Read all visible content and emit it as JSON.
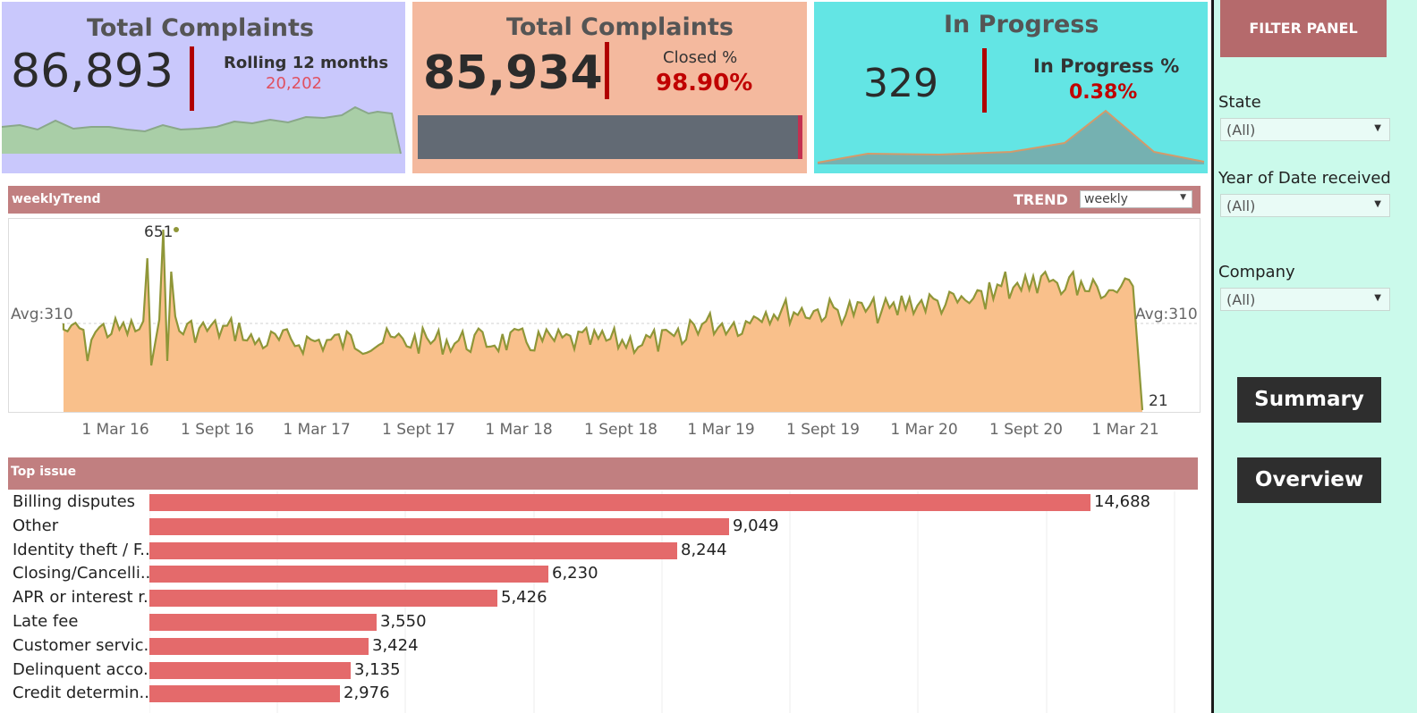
{
  "kpi": {
    "total": {
      "title": "Total Complaints",
      "value": "86,893",
      "rolling_label": "Rolling 12 months",
      "rolling_value": "20,202"
    },
    "closed": {
      "title": "Total Complaints",
      "value": "85,934",
      "pct_label": "Closed %",
      "pct_value": "98.90%",
      "progress": 0.989
    },
    "inprogress": {
      "title": "In Progress",
      "value": "329",
      "pct_label": "In Progress %",
      "pct_value": "0.38%"
    }
  },
  "weekly": {
    "title": "weeklyTrend",
    "trend_label": "TREND",
    "trend_select": "weekly",
    "avg_left": "Avg:310",
    "avg_right": "Avg:310",
    "peak_label": "651",
    "last_label": "21",
    "ticks": [
      "1 Mar 16",
      "1 Sept 16",
      "1 Mar 17",
      "1 Sept 17",
      "1 Mar 18",
      "1 Sept 18",
      "1 Mar 19",
      "1 Sept 19",
      "1 Mar 20",
      "1 Sept 20",
      "1 Mar 21"
    ]
  },
  "top_issue": {
    "title": "Top issue",
    "items": [
      {
        "label": "Billing disputes",
        "value": 14688,
        "display": "14,688"
      },
      {
        "label": "Other",
        "value": 9049,
        "display": "9,049"
      },
      {
        "label": "Identity theft / F..",
        "value": 8244,
        "display": "8,244"
      },
      {
        "label": "Closing/Cancelli..",
        "value": 6230,
        "display": "6,230"
      },
      {
        "label": "APR or interest r..",
        "value": 5426,
        "display": "5,426"
      },
      {
        "label": "Late fee",
        "value": 3550,
        "display": "3,550"
      },
      {
        "label": "Customer servic..",
        "value": 3424,
        "display": "3,424"
      },
      {
        "label": "Delinquent acco..",
        "value": 3135,
        "display": "3,135"
      },
      {
        "label": "Credit determin..",
        "value": 2976,
        "display": "2,976"
      }
    ]
  },
  "filter_panel": {
    "title": "FILTER PANEL",
    "state_label": "State",
    "state_value": "(All)",
    "year_label": "Year of Date received",
    "year_value": "(All)",
    "company_label": "Company",
    "company_value": "(All)",
    "summary_button": "Summary",
    "overview_button": "Overview"
  },
  "colors": {
    "card_total": "#c9c8fc",
    "card_closed": "#f4b99e",
    "card_inprogress": "#63e5e4",
    "band": "#c17f80",
    "bar": "#e46a6b",
    "panel": "#cbfaeb",
    "trend_fill": "#f9c08b",
    "trend_line": "#8f9638"
  }
}
